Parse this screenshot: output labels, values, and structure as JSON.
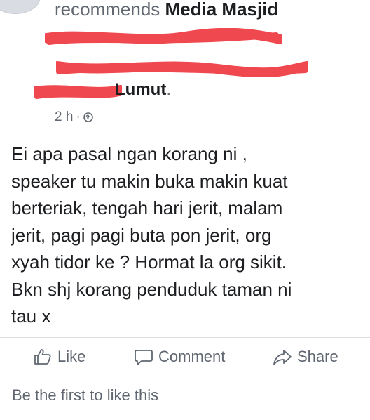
{
  "post": {
    "recommends_text": "recommends",
    "page_name": "Media Masjid",
    "location_tail": "Lumut",
    "timestamp": "2 h",
    "meta_separator": "·",
    "privacy_icon": "public-globe-icon",
    "lines": [
      "Ei apa pasal ngan korang ni ,",
      "speaker tu makin buka makin kuat",
      "berteriak, tengah hari jerit, malam",
      "jerit, pagi pagi buta pon jerit, org",
      "xyah tidor ke ? Hormat la org sikit.",
      "Bkn shj korang penduduk taman ni",
      "tau x"
    ]
  },
  "actions": {
    "like_label": "Like",
    "comment_label": "Comment",
    "share_label": "Share"
  },
  "likes_summary": "Be the first to like this",
  "colors": {
    "redaction": "#f0484f",
    "secondary_text": "#606770",
    "primary_text": "#1c1e21",
    "divider": "#dadde1"
  }
}
